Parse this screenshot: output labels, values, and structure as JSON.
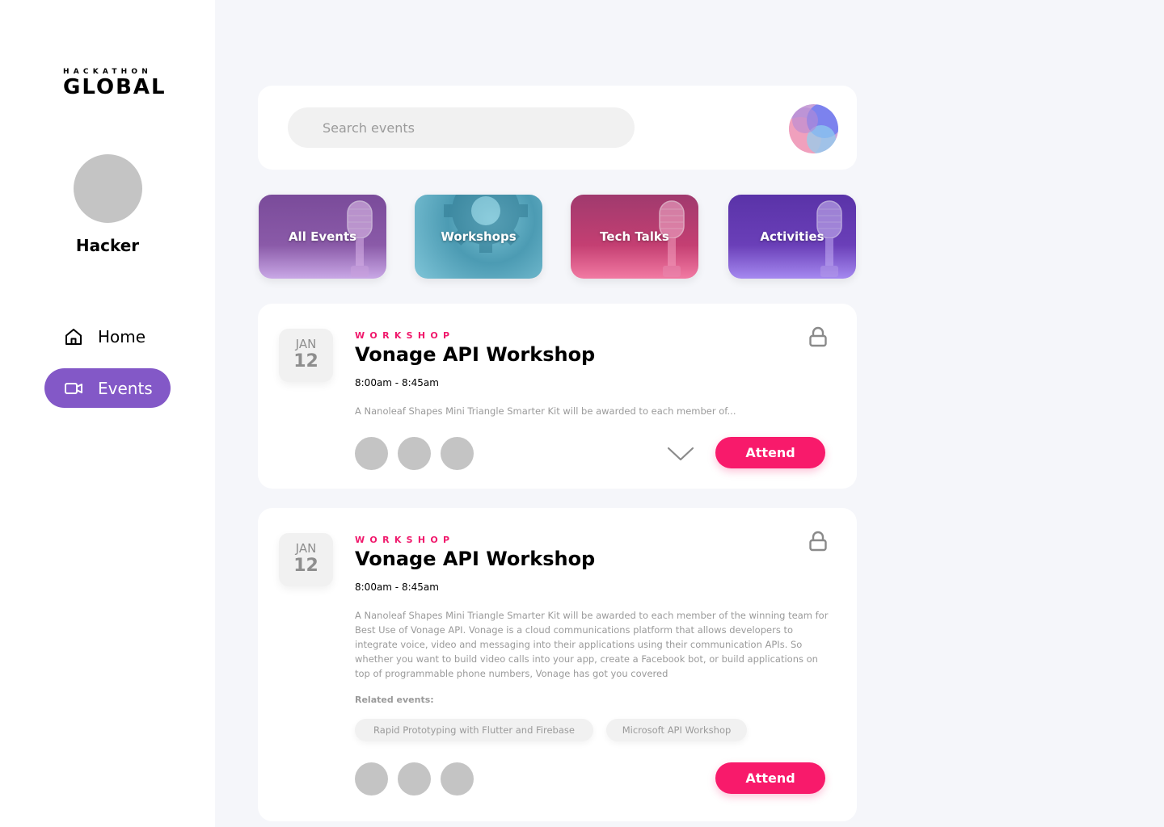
{
  "brand": {
    "small": "HACKATHON",
    "big": "GLOBAL"
  },
  "user": {
    "name": "Hacker"
  },
  "nav": [
    {
      "label": "Home",
      "icon": "home-icon"
    },
    {
      "label": "Events",
      "icon": "video-camera-icon",
      "active": true
    }
  ],
  "search": {
    "placeholder": "Search events"
  },
  "categories": [
    {
      "label": "All Events"
    },
    {
      "label": "Workshops"
    },
    {
      "label": "Tech Talks"
    },
    {
      "label": "Activities"
    }
  ],
  "events": [
    {
      "month": "JAN",
      "day": "12",
      "tag": "WORKSHOP",
      "title": "Vonage API Workshop",
      "time": "8:00am - 8:45am",
      "description": "A Nanoleaf Shapes Mini Triangle Smarter Kit will be awarded to each member of...",
      "attend_label": "Attend"
    },
    {
      "month": "JAN",
      "day": "12",
      "tag": "WORKSHOP",
      "title": "Vonage API Workshop",
      "time": "8:00am - 8:45am",
      "description": "A Nanoleaf Shapes Mini Triangle Smarter Kit will be awarded to each member of the winning team for Best Use of Vonage API. Vonage is a cloud communications platform that allows developers to integrate voice, video and messaging into their applications using their communication APIs. So whether you want to build video calls into your app, create a Facebook bot, or build applications on top of programmable phone numbers, Vonage has got you covered",
      "related_label": "Related events:",
      "related": [
        "Rapid Prototyping with Flutter and Firebase",
        "Microsoft API Workshop"
      ],
      "attend_label": "Attend"
    }
  ],
  "colors": {
    "accent": "#8358c7",
    "attend": "#f81a6b",
    "tag": "#f0196c"
  }
}
